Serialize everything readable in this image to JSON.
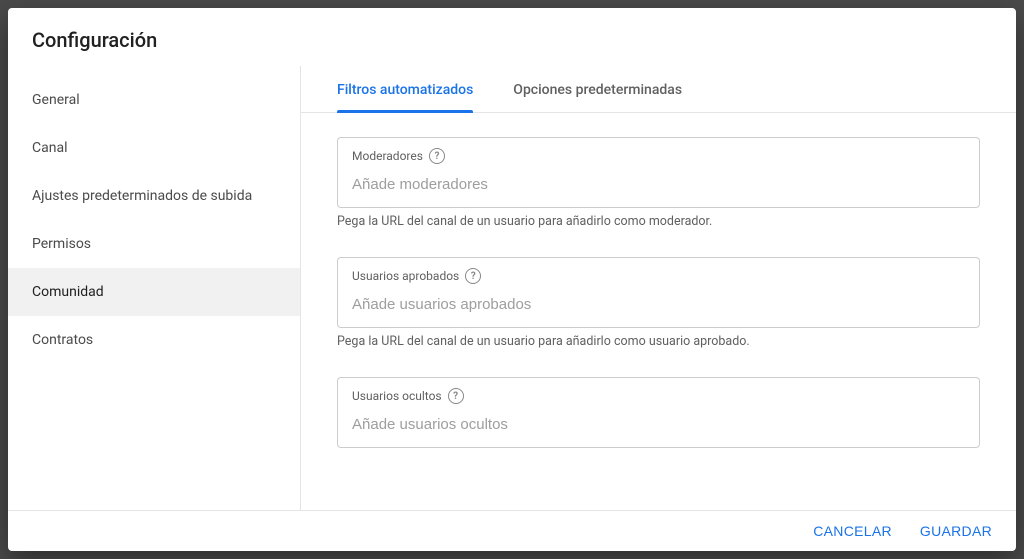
{
  "header": {
    "title": "Configuración"
  },
  "sidebar": {
    "items": [
      {
        "label": "General"
      },
      {
        "label": "Canal"
      },
      {
        "label": "Ajustes predeterminados de subida"
      },
      {
        "label": "Permisos"
      },
      {
        "label": "Comunidad"
      },
      {
        "label": "Contratos"
      }
    ]
  },
  "tabs": [
    {
      "label": "Filtros automatizados"
    },
    {
      "label": "Opciones predeterminadas"
    }
  ],
  "sections": {
    "moderators": {
      "label": "Moderadores",
      "placeholder": "Añade moderadores",
      "helper": "Pega la URL del canal de un usuario para añadirlo como moderador."
    },
    "approved": {
      "label": "Usuarios aprobados",
      "placeholder": "Añade usuarios aprobados",
      "helper": "Pega la URL del canal de un usuario para añadirlo como usuario aprobado."
    },
    "hidden": {
      "label": "Usuarios ocultos",
      "placeholder": "Añade usuarios ocultos",
      "helper": ""
    }
  },
  "footer": {
    "cancel": "CANCELAR",
    "save": "GUARDAR"
  }
}
